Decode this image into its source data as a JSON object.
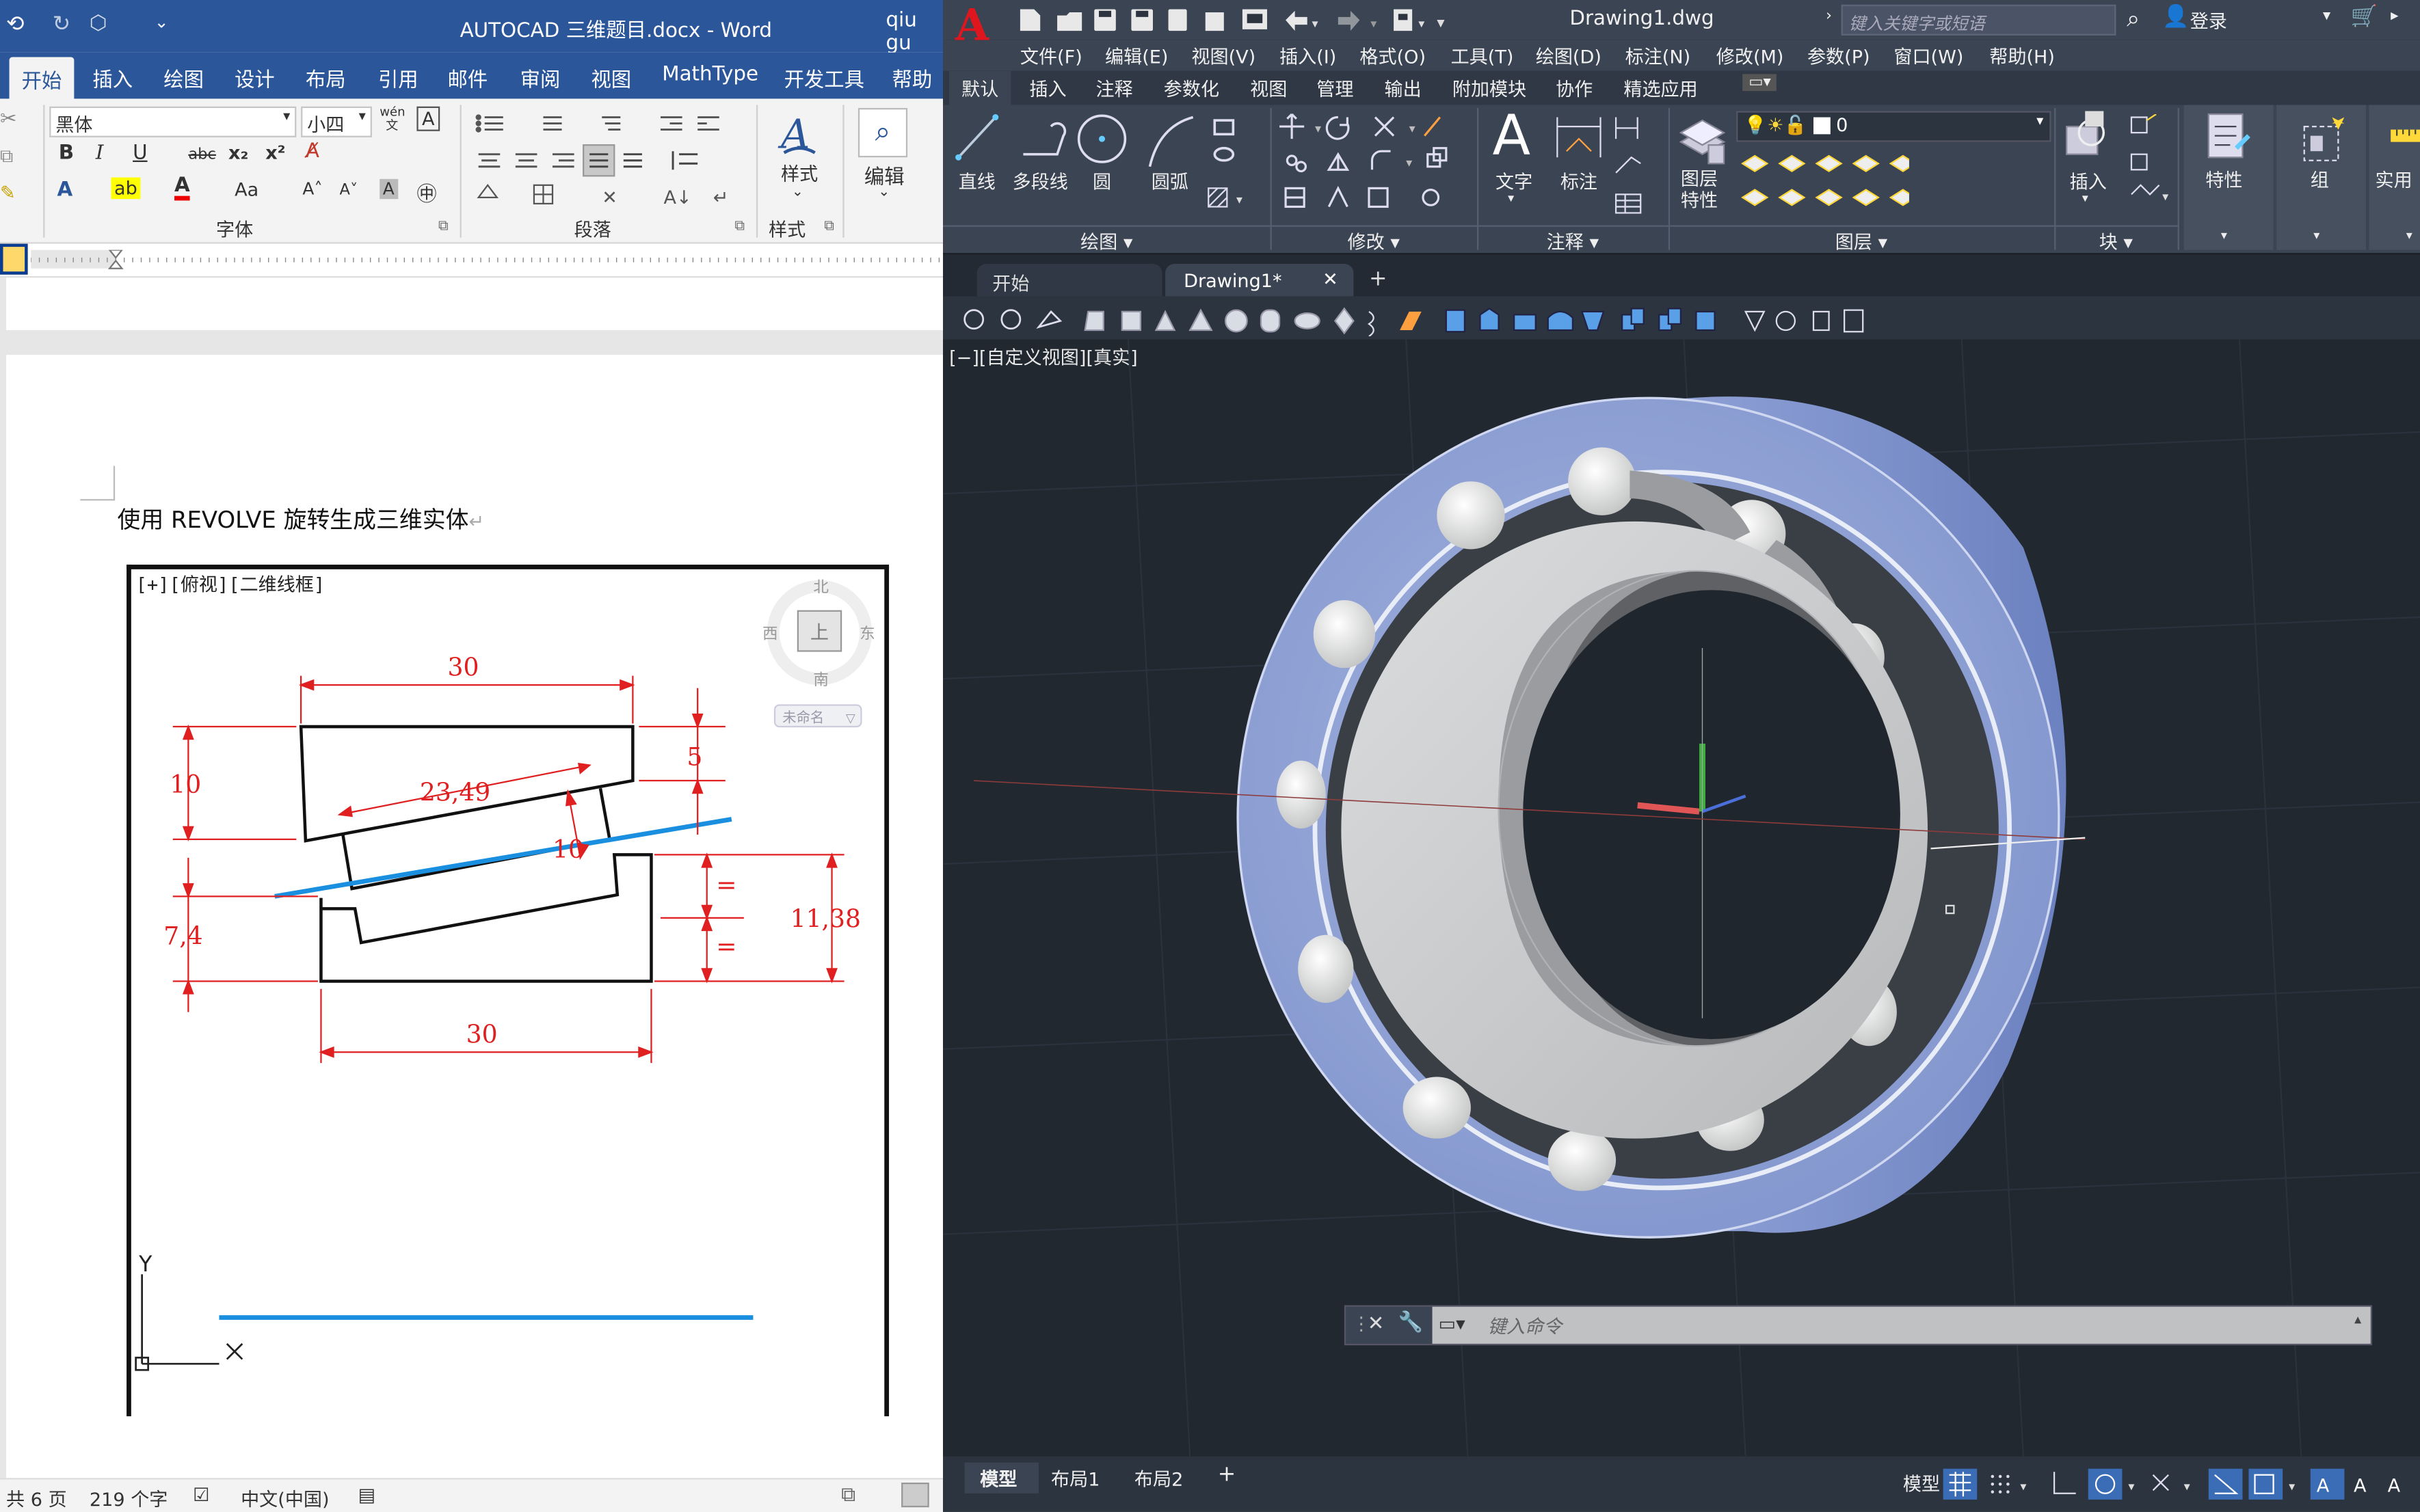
{
  "word": {
    "title_bar": {
      "doc_title": "AUTOCAD 三维题目.docx  -  Word",
      "user": "qiu gu"
    },
    "tabs": [
      "开始",
      "插入",
      "绘图",
      "设计",
      "布局",
      "引用",
      "邮件",
      "审阅",
      "视图",
      "MathType",
      "开发工具",
      "帮助"
    ],
    "ribbon": {
      "font_name": "黑体",
      "font_size": "小四",
      "group_font": "字体",
      "group_paragraph": "段落",
      "group_styles": "样式",
      "styles_label": "样式",
      "edit_label": "编辑",
      "btn_bold": "B",
      "btn_italic": "I",
      "btn_underline": "U",
      "btn_strike": "abc",
      "btn_sub": "x₂",
      "btn_sup": "x²",
      "btn_aa": "Aa",
      "btn_wen": "wén 文",
      "btn_a_box": "A"
    },
    "document": {
      "heading": "使用 REVOLVE 旋转生成三维实体",
      "drawing": {
        "view_label": "[+][俯视][二维线框]",
        "viewcube": {
          "north": "北",
          "south": "南",
          "west": "西",
          "east": "东",
          "top": "上",
          "wcs": "未命名"
        },
        "dims": [
          "30",
          "10",
          "5",
          "23,49",
          "10",
          "7,4",
          "11,38",
          "30",
          "=",
          "="
        ],
        "axis_y": "Y",
        "axis_x": "X"
      }
    },
    "status_bar": {
      "pages": "共 6 页",
      "words": "219 个字",
      "language": "中文(中国)"
    }
  },
  "cad": {
    "title_bar": {
      "title": "Drawing1.dwg",
      "search_placeholder": "键入关键字或短语",
      "login": "登录"
    },
    "menu": [
      "文件(F)",
      "编辑(E)",
      "视图(V)",
      "插入(I)",
      "格式(O)",
      "工具(T)",
      "绘图(D)",
      "标注(N)",
      "修改(M)",
      "参数(P)",
      "窗口(W)",
      "帮助(H)"
    ],
    "ribbon_tabs": [
      "默认",
      "插入",
      "注释",
      "参数化",
      "视图",
      "管理",
      "输出",
      "附加模块",
      "协作",
      "精选应用"
    ],
    "ribbon": {
      "draw_tools": [
        "直线",
        "多段线",
        "圆",
        "圆弧"
      ],
      "text_tools": [
        "文字",
        "标注"
      ],
      "layer_tools": [
        "图层特性"
      ],
      "layer_current": "0",
      "block_tools": [
        "插入"
      ],
      "props_tools": [
        "特性"
      ],
      "group_tools": [
        "组"
      ],
      "util_tools": [
        "实用"
      ],
      "panels": [
        "绘图",
        "修改",
        "注释",
        "图层",
        "块"
      ]
    },
    "file_tabs": [
      "开始",
      "Drawing1*"
    ],
    "viewport_label": "[−][自定义视图][真实]",
    "command_placeholder": "键入命令",
    "layout_tabs": [
      "模型",
      "布局1",
      "布局2"
    ],
    "status_model": "模型",
    "colors": {
      "accent": "#0696d7",
      "cad_bg": "#212830",
      "word_blue": "#2b579a"
    }
  }
}
